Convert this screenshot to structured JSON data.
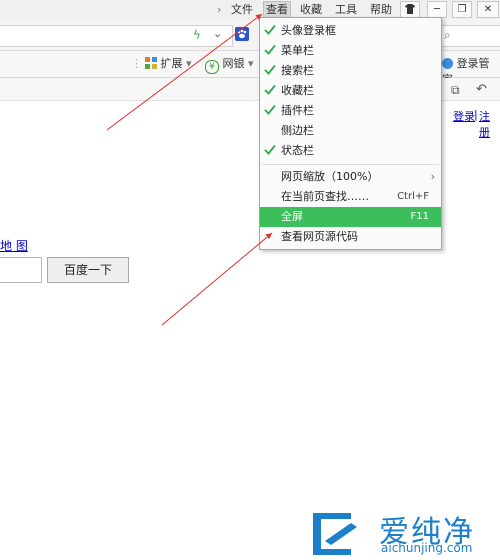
{
  "menubar": {
    "items": [
      "文件",
      "查看",
      "收藏",
      "工具",
      "帮助"
    ],
    "active": "查看",
    "window_controls": [
      "skin-icon",
      "minimize-icon",
      "restore-icon",
      "close-icon"
    ]
  },
  "toolbar": {
    "extensions_label": "扩展",
    "netbank_label": "网银",
    "login_manager_label": "登录管家"
  },
  "nav": {
    "login": "登录",
    "register": "注册"
  },
  "page": {
    "map_link": "地 图",
    "search_button": "百度一下"
  },
  "view_menu": {
    "items": [
      {
        "label": "头像登录框",
        "checked": true
      },
      {
        "label": "菜单栏",
        "checked": true
      },
      {
        "label": "搜索栏",
        "checked": true
      },
      {
        "label": "收藏栏",
        "checked": true
      },
      {
        "label": "插件栏",
        "checked": true
      },
      {
        "label": "侧边栏",
        "checked": false
      },
      {
        "label": "状态栏",
        "checked": true
      },
      {
        "label": "网页缩放（100%）",
        "submenu": true
      },
      {
        "label": "在当前页查找……",
        "shortcut": "Ctrl+F"
      },
      {
        "label": "全屏",
        "shortcut": "F11",
        "highlighted": true
      },
      {
        "label": "查看网页源代码"
      }
    ],
    "highlight_color": "#3cbf5b",
    "check_color": "#2ea84b"
  },
  "watermark": {
    "name": "爱纯净",
    "url": "aichunjing.com",
    "color": "#1b7fc9"
  },
  "annotation_color": "#e0322d"
}
